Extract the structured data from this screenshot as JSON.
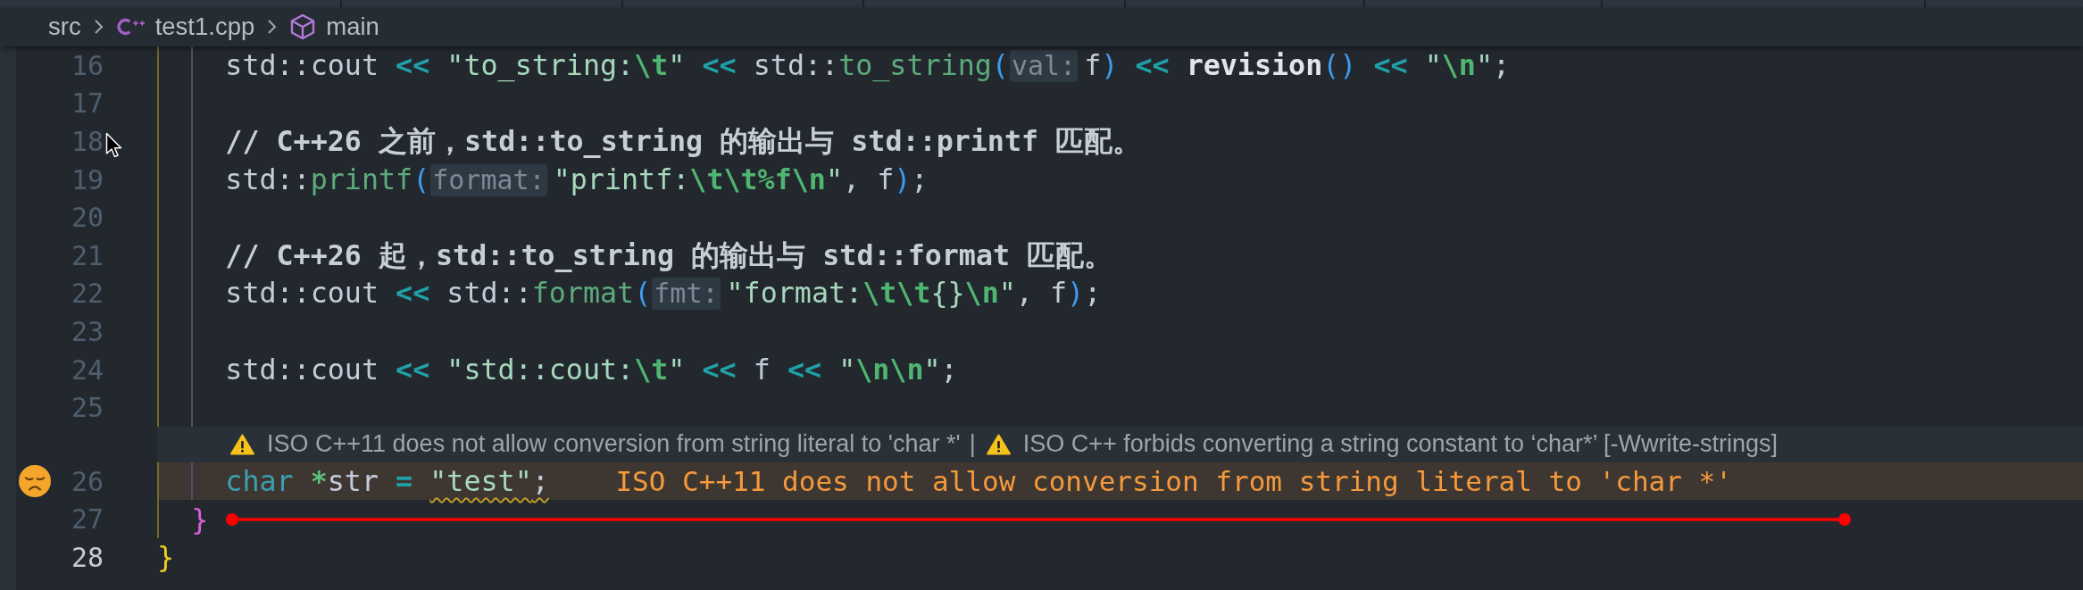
{
  "breadcrumb": [
    {
      "kind": "folder",
      "label": "src"
    },
    {
      "kind": "file",
      "label": "test1.cpp"
    },
    {
      "kind": "symbol",
      "label": "main"
    }
  ],
  "editor": {
    "lines": [
      {
        "kind": "code",
        "number": "16",
        "active": false,
        "hovered": false,
        "tokens": [
          {
            "kind": "plain",
            "text": "    std::cout "
          },
          {
            "kind": "operator",
            "text": "<< "
          },
          {
            "kind": "string",
            "text": "\"to_string:"
          },
          {
            "kind": "escape",
            "text": "\\t"
          },
          {
            "kind": "string",
            "text": "\" "
          },
          {
            "kind": "operator",
            "text": "<< "
          },
          {
            "kind": "plain",
            "text": "std::"
          },
          {
            "kind": "function",
            "text": "to_string"
          },
          {
            "kind": "paren",
            "text": "("
          },
          {
            "kind": "hint",
            "text": "val:"
          },
          {
            "kind": "plain",
            "text": "f"
          },
          {
            "kind": "paren",
            "text": ") "
          },
          {
            "kind": "operator",
            "text": "<< "
          },
          {
            "kind": "call",
            "text": "revision"
          },
          {
            "kind": "paren",
            "text": "() "
          },
          {
            "kind": "operator",
            "text": "<< "
          },
          {
            "kind": "string",
            "text": "\""
          },
          {
            "kind": "escape",
            "text": "\\n"
          },
          {
            "kind": "string",
            "text": "\""
          },
          {
            "kind": "plain",
            "text": ";"
          }
        ]
      },
      {
        "kind": "code",
        "number": "17",
        "active": false,
        "hovered": false
      },
      {
        "kind": "code",
        "number": "18",
        "active": false,
        "hovered": true,
        "tokens": [
          {
            "kind": "comment",
            "text": "    // C++26 之前，std::to_string 的输出与 std::printf 匹配。"
          }
        ]
      },
      {
        "kind": "code",
        "number": "19",
        "active": false,
        "hovered": false,
        "tokens": [
          {
            "kind": "plain",
            "text": "    std::"
          },
          {
            "kind": "function",
            "text": "printf"
          },
          {
            "kind": "paren",
            "text": "("
          },
          {
            "kind": "hint",
            "text": "format:"
          },
          {
            "kind": "string",
            "text": "\"printf:"
          },
          {
            "kind": "escape",
            "text": "\\t\\t%f\\n"
          },
          {
            "kind": "string",
            "text": "\""
          },
          {
            "kind": "plain",
            "text": ", f"
          },
          {
            "kind": "paren",
            "text": ")"
          },
          {
            "kind": "plain",
            "text": ";"
          }
        ]
      },
      {
        "kind": "code",
        "number": "20",
        "active": false,
        "hovered": false
      },
      {
        "kind": "code",
        "number": "21",
        "active": false,
        "hovered": false,
        "tokens": [
          {
            "kind": "comment",
            "text": "    // C++26 起，std::to_string 的输出与 std::format 匹配。"
          }
        ]
      },
      {
        "kind": "code",
        "number": "22",
        "active": false,
        "hovered": false,
        "tokens": [
          {
            "kind": "plain",
            "text": "    std::cout "
          },
          {
            "kind": "operator",
            "text": "<< "
          },
          {
            "kind": "plain",
            "text": "std::"
          },
          {
            "kind": "function",
            "text": "format"
          },
          {
            "kind": "paren",
            "text": "("
          },
          {
            "kind": "hint",
            "text": "fmt:"
          },
          {
            "kind": "string",
            "text": "\"format:"
          },
          {
            "kind": "escape",
            "text": "\\t\\t"
          },
          {
            "kind": "string",
            "text": "{}"
          },
          {
            "kind": "escape",
            "text": "\\n"
          },
          {
            "kind": "string",
            "text": "\""
          },
          {
            "kind": "plain",
            "text": ", f"
          },
          {
            "kind": "paren",
            "text": ")"
          },
          {
            "kind": "plain",
            "text": ";"
          }
        ]
      },
      {
        "kind": "code",
        "number": "23",
        "active": false,
        "hovered": false
      },
      {
        "kind": "code",
        "number": "24",
        "active": false,
        "hovered": false,
        "tokens": [
          {
            "kind": "plain",
            "text": "    std::cout "
          },
          {
            "kind": "operator",
            "text": "<< "
          },
          {
            "kind": "string",
            "text": "\"std::cout:"
          },
          {
            "kind": "escape",
            "text": "\\t"
          },
          {
            "kind": "string",
            "text": "\" "
          },
          {
            "kind": "operator",
            "text": "<< "
          },
          {
            "kind": "plain",
            "text": "f "
          },
          {
            "kind": "operator",
            "text": "<< "
          },
          {
            "kind": "string",
            "text": "\""
          },
          {
            "kind": "escape",
            "text": "\\n\\n"
          },
          {
            "kind": "string",
            "text": "\""
          },
          {
            "kind": "plain",
            "text": ";"
          }
        ]
      },
      {
        "kind": "code",
        "number": "25",
        "active": false,
        "hovered": false
      },
      {
        "kind": "diagnostic",
        "separator": "|",
        "messages": [
          {
            "kind": "warning",
            "text": "ISO C++11 does not allow conversion from string literal to 'char *'"
          },
          {
            "kind": "warning",
            "text": "ISO C++ forbids converting a string constant to ‘char*’ [-Wwrite-strings]"
          }
        ]
      },
      {
        "kind": "code",
        "number": "26",
        "active": false,
        "hovered": false,
        "warning": true,
        "message": "ISO C++11 does not allow conversion from string literal to 'char *'",
        "tokens": [
          {
            "kind": "keyword",
            "text": "    char ",
            "squiggly": false
          },
          {
            "kind": "modifier",
            "text": "*",
            "squiggly": false
          },
          {
            "kind": "plain",
            "text": "str ",
            "squiggly": false
          },
          {
            "kind": "operator",
            "text": "= ",
            "squiggly": false
          },
          {
            "kind": "string",
            "text": "\"test\"",
            "squiggly": true
          },
          {
            "kind": "plain",
            "text": ";",
            "squiggly": true
          }
        ]
      },
      {
        "kind": "code",
        "number": "27",
        "active": false,
        "hovered": false,
        "marked": true,
        "tokens": [
          {
            "kind": "innerbrace",
            "text": "  }"
          }
        ]
      },
      {
        "kind": "code",
        "number": "28",
        "active": true,
        "hovered": false,
        "tokens": [
          {
            "kind": "brace",
            "text": "}"
          }
        ]
      }
    ]
  }
}
